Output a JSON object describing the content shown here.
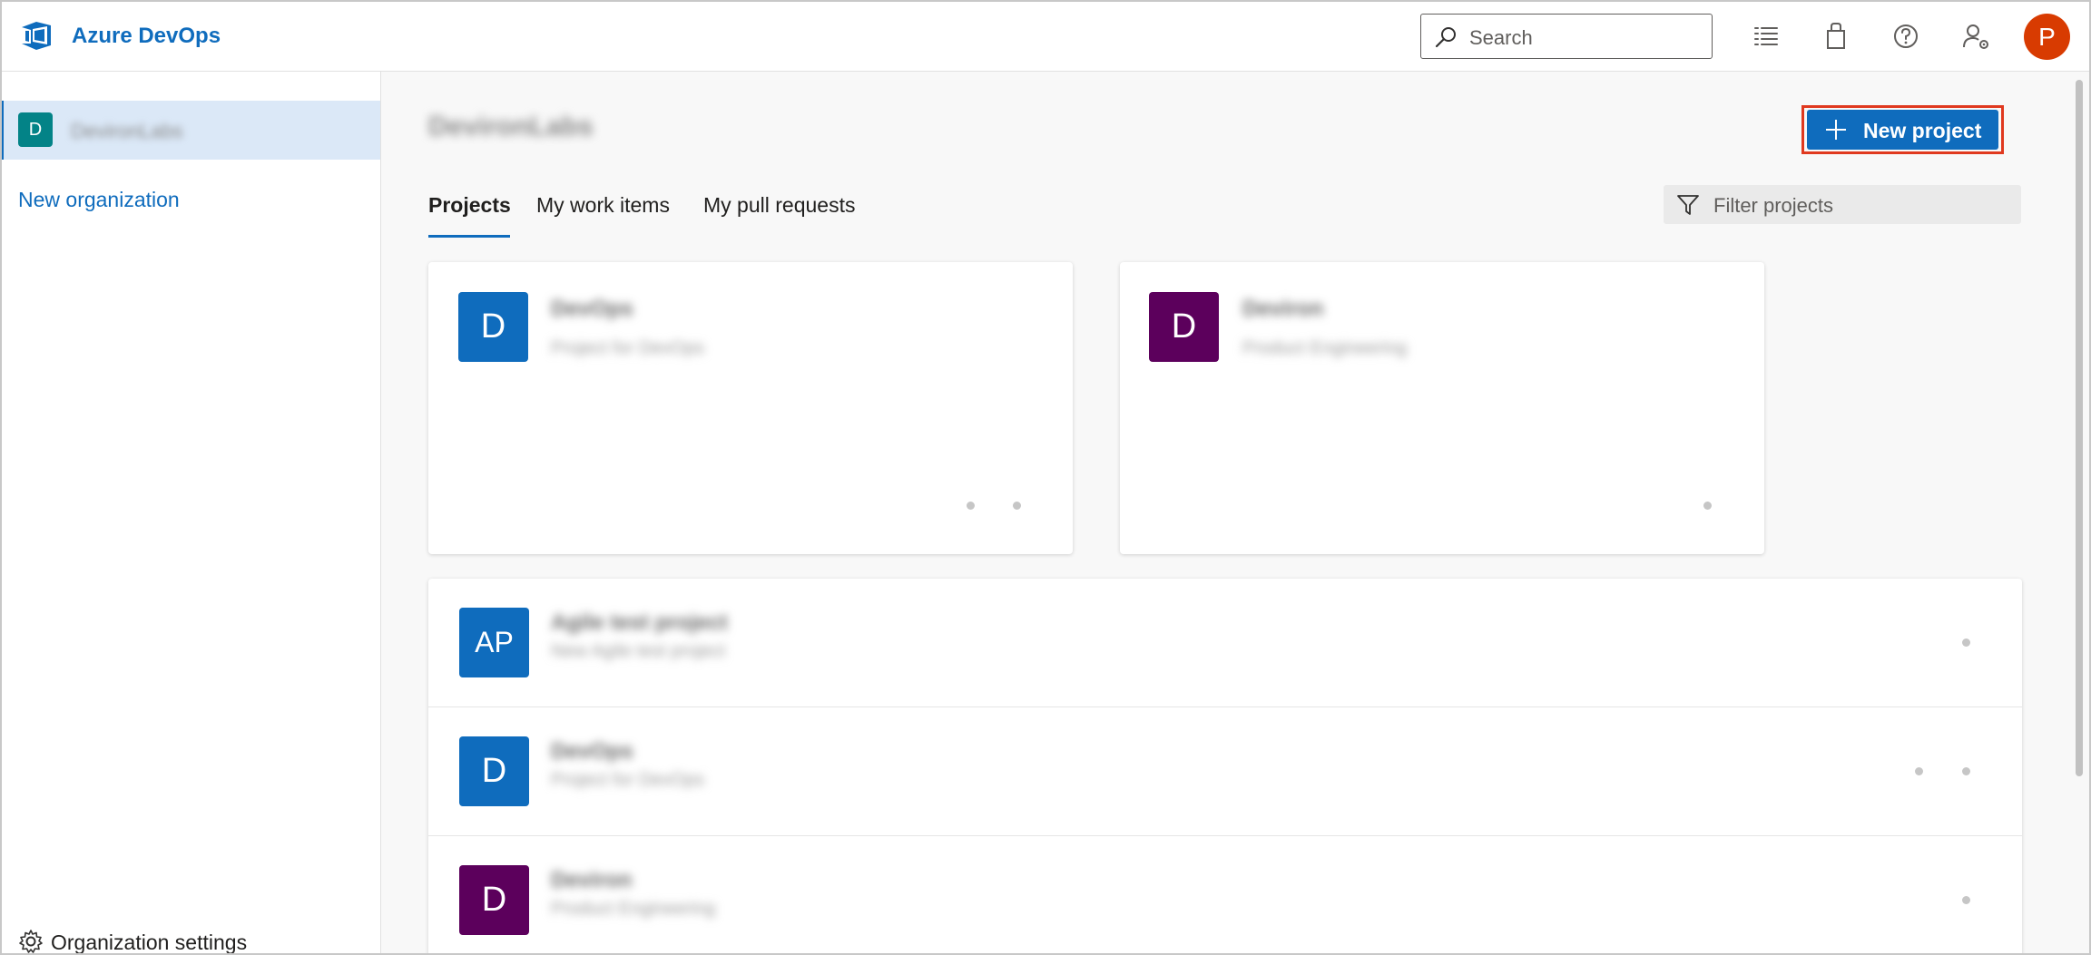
{
  "header": {
    "brand": "Azure DevOps",
    "search_placeholder": "Search",
    "icons": [
      "work-items-icon",
      "marketplace-bag-icon",
      "help-icon",
      "user-settings-icon"
    ],
    "avatar_initial": "P"
  },
  "sidebar": {
    "org_badge": "D",
    "org_name": "DevironLabs",
    "new_org_label": "New organization",
    "settings_label": "Organization settings"
  },
  "main": {
    "org_title": "DevironLabs",
    "new_project_label": "New project",
    "tabs": [
      {
        "label": "Projects",
        "active": true
      },
      {
        "label": "My work items",
        "active": false
      },
      {
        "label": "My pull requests",
        "active": false
      }
    ],
    "filter_placeholder": "Filter projects",
    "cards": [
      {
        "badge": "D",
        "name": "DevOps",
        "description": "Project for DevOps",
        "color": "#0f6cbd"
      },
      {
        "badge": "D",
        "name": "Deviron",
        "description": "Product Engineering",
        "color": "#5c005c"
      }
    ],
    "rows": [
      {
        "badge": "AP",
        "name": "Agile test project",
        "description": "New Agile test project",
        "color": "#0f6cbd"
      },
      {
        "badge": "D",
        "name": "DevOps",
        "description": "Project for DevOps",
        "color": "#0f6cbd"
      },
      {
        "badge": "D",
        "name": "Deviron",
        "description": "Product Engineering",
        "color": "#5c005c"
      }
    ]
  },
  "colors": {
    "accent": "#0f6cbd",
    "highlight_outline": "#e0391f",
    "avatar": "#d83b01",
    "org_badge": "#038387"
  }
}
